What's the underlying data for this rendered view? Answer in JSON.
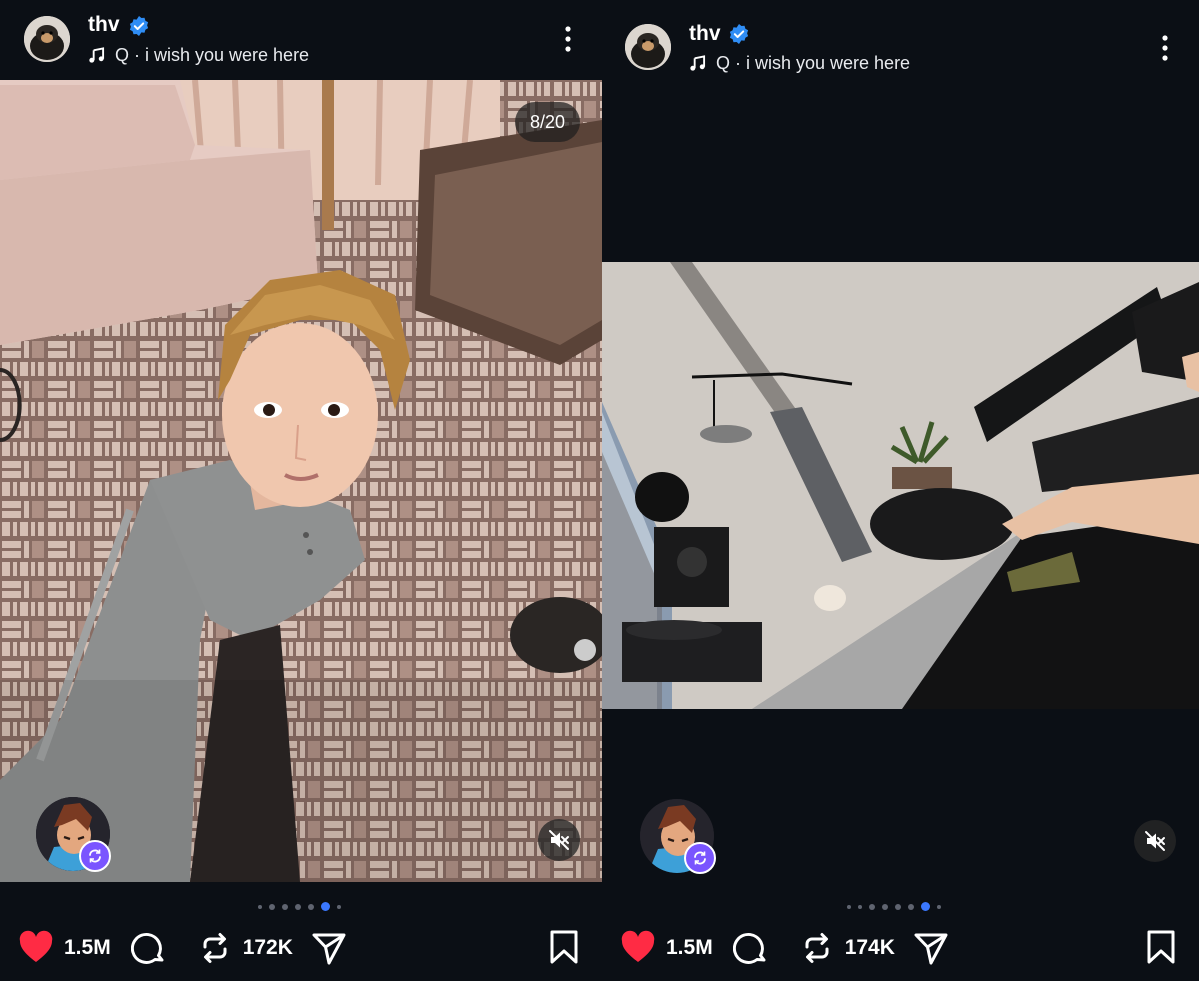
{
  "posts": [
    {
      "username": "thv",
      "music": "Q · i wish you were here",
      "counter": "8/20",
      "likes": "1.5M",
      "reposts": "172K",
      "carousel": {
        "count": 7,
        "active": 5
      }
    },
    {
      "username": "thv",
      "music": "Q · i wish you were here",
      "likes": "1.5M",
      "reposts": "174K",
      "carousel": {
        "count": 8,
        "active": 6
      }
    }
  ],
  "colors": {
    "background": "#0b0f15",
    "verified": "#2f8df5",
    "like": "#ff2b44",
    "active_dot": "#3a78ff",
    "remix_badge": "#7a55ff"
  },
  "icons": [
    "verified-icon",
    "music-note-icon",
    "more-icon",
    "mute-icon",
    "remix-icon",
    "heart-icon",
    "comment-icon",
    "repost-icon",
    "share-icon",
    "bookmark-icon"
  ]
}
